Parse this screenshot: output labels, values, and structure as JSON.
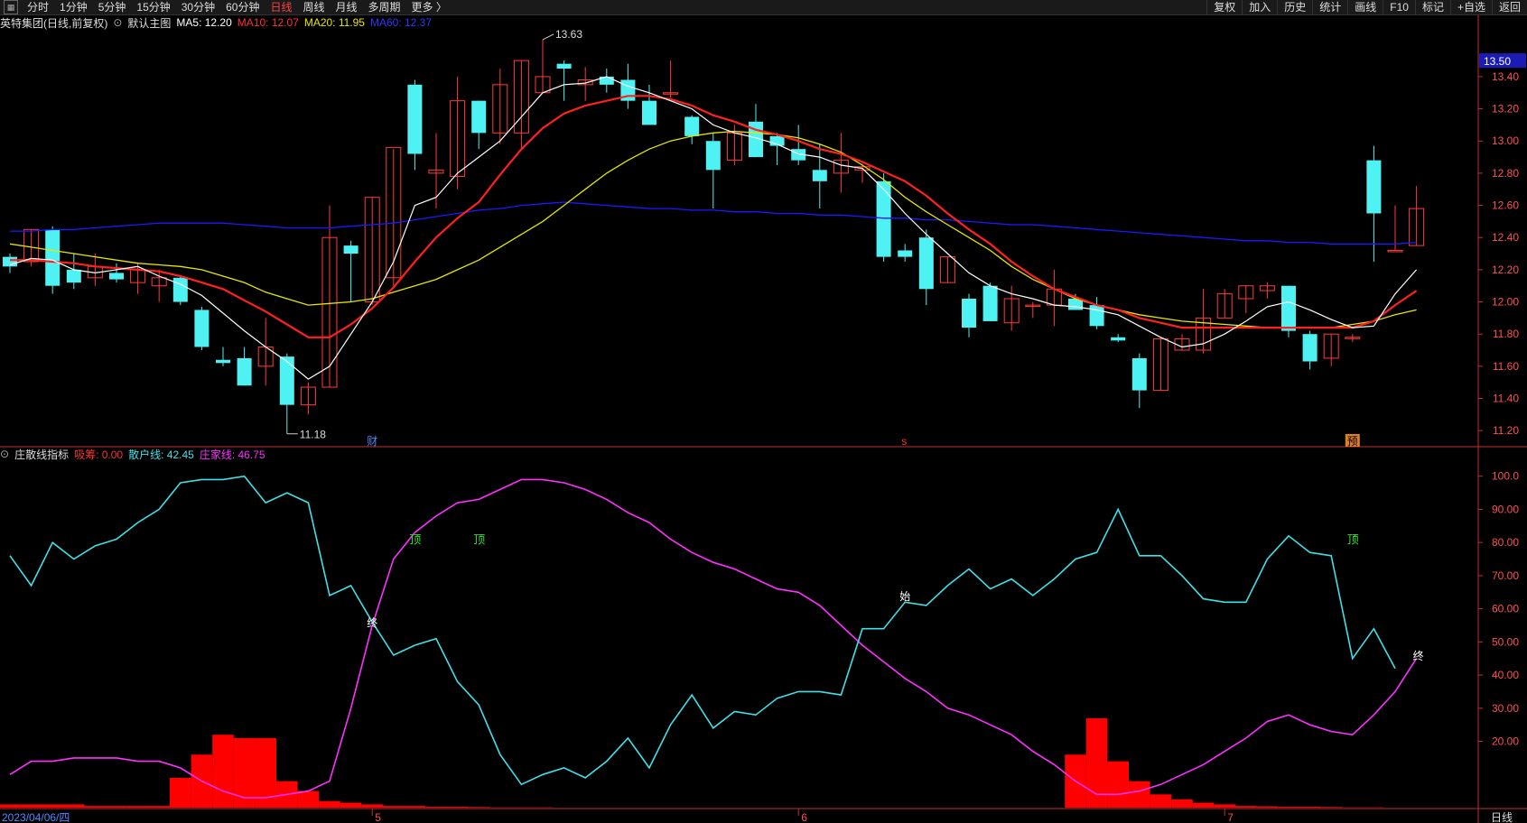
{
  "toolbar": {
    "items": [
      "分时",
      "1分钟",
      "5分钟",
      "15分钟",
      "30分钟",
      "60分钟",
      "日线",
      "周线",
      "月线",
      "多周期",
      "更多 〉"
    ],
    "active": "日线",
    "right_items": [
      "复权",
      "加入",
      "历史",
      "统计",
      "画线",
      "F10",
      "标记",
      "+自选",
      "返回"
    ]
  },
  "main_header": {
    "stock": "英特集团(日线,前复权)",
    "chart_name": "默认主图",
    "ma5_label": "MA5: 12.20",
    "ma10_label": "MA10: 12.07",
    "ma20_label": "MA20: 11.95",
    "ma60_label": "MA60: 12.37"
  },
  "sub_header": {
    "indicator": "庄散线指标",
    "xichou_label": "吸筹: 0.00",
    "sanhu_label": "散户线: 42.45",
    "zhuangjia_label": "庄家线: 46.75"
  },
  "colors": {
    "up": "#ff3a3a",
    "down": "#4ef2f2",
    "ma5": "#ffffff",
    "ma10": "#ff2020",
    "ma20": "#e6e600",
    "ma60": "#1a1aff",
    "sanhu": "#40e0e8",
    "zhuangjia": "#ff30ff",
    "xichou": "#ff0000"
  },
  "main_axis": {
    "ticks": [
      "13.40",
      "13.20",
      "13.00",
      "12.80",
      "12.60",
      "12.40",
      "12.20",
      "12.00",
      "11.80",
      "11.60",
      "11.40",
      "11.20"
    ],
    "current_price": "13.50",
    "high_label": "13.63",
    "low_label": "11.18"
  },
  "sub_axis": {
    "ticks": [
      "100.0",
      "90.00",
      "80.00",
      "70.00",
      "60.00",
      "50.00",
      "40.00",
      "30.00",
      "20.00"
    ]
  },
  "markers": {
    "cai": "财",
    "s": "s",
    "yu": "预",
    "ding": "顶",
    "zhong": "终",
    "shi": "始"
  },
  "date_axis": {
    "start": "2023/04/06/四",
    "month_labels": [
      "5",
      "6",
      "7"
    ],
    "period": "日线"
  },
  "chart_data": [
    {
      "type": "candlestick",
      "title": "英特集团(日线,前复权)",
      "ylim": [
        11.1,
        13.68
      ],
      "candles": [
        [
          12.28,
          12.3,
          12.18,
          12.22
        ],
        [
          12.25,
          12.45,
          12.22,
          12.45
        ],
        [
          12.45,
          12.47,
          12.05,
          12.1
        ],
        [
          12.2,
          12.3,
          12.08,
          12.12
        ],
        [
          12.15,
          12.3,
          12.1,
          12.22
        ],
        [
          12.18,
          12.24,
          12.12,
          12.14
        ],
        [
          12.12,
          12.24,
          12.05,
          12.2
        ],
        [
          12.1,
          12.2,
          12.0,
          12.15
        ],
        [
          12.15,
          12.16,
          11.98,
          12.0
        ],
        [
          11.95,
          11.97,
          11.7,
          11.72
        ],
        [
          11.64,
          11.72,
          11.6,
          11.62
        ],
        [
          11.65,
          11.72,
          11.48,
          11.48
        ],
        [
          11.6,
          11.9,
          11.48,
          11.72
        ],
        [
          11.66,
          11.68,
          11.18,
          11.36
        ],
        [
          11.36,
          11.5,
          11.3,
          11.47
        ],
        [
          11.47,
          12.6,
          11.47,
          12.4
        ],
        [
          12.35,
          12.38,
          12.0,
          12.3
        ],
        [
          12.0,
          12.65,
          11.98,
          12.65
        ],
        [
          12.15,
          12.95,
          12.1,
          12.96
        ],
        [
          13.35,
          13.38,
          12.82,
          12.92
        ],
        [
          12.8,
          13.05,
          12.58,
          12.82
        ],
        [
          12.78,
          13.4,
          12.7,
          13.25
        ],
        [
          13.25,
          13.25,
          12.95,
          13.05
        ],
        [
          13.05,
          13.45,
          12.98,
          13.35
        ],
        [
          13.05,
          13.5,
          12.95,
          13.5
        ],
        [
          13.3,
          13.63,
          13.3,
          13.4
        ],
        [
          13.48,
          13.5,
          13.25,
          13.45
        ],
        [
          13.35,
          13.46,
          13.25,
          13.38
        ],
        [
          13.4,
          13.45,
          13.3,
          13.35
        ],
        [
          13.38,
          13.48,
          13.2,
          13.25
        ],
        [
          13.25,
          13.35,
          13.1,
          13.1
        ],
        [
          13.3,
          13.5,
          13.27,
          13.3
        ],
        [
          13.15,
          13.16,
          12.98,
          13.03
        ],
        [
          13.0,
          13.05,
          12.58,
          12.82
        ],
        [
          12.88,
          13.1,
          12.85,
          13.05
        ],
        [
          13.12,
          13.23,
          12.9,
          12.9
        ],
        [
          13.03,
          13.05,
          12.85,
          12.97
        ],
        [
          12.95,
          13.1,
          12.85,
          12.88
        ],
        [
          12.82,
          12.98,
          12.58,
          12.75
        ],
        [
          12.8,
          13.05,
          12.68,
          12.88
        ],
        [
          12.82,
          12.86,
          12.74,
          12.84
        ],
        [
          12.75,
          12.8,
          12.25,
          12.28
        ],
        [
          12.32,
          12.36,
          12.25,
          12.28
        ],
        [
          12.4,
          12.45,
          11.98,
          12.08
        ],
        [
          12.12,
          12.28,
          12.12,
          12.28
        ],
        [
          12.02,
          12.05,
          11.78,
          11.84
        ],
        [
          12.1,
          12.12,
          11.88,
          11.88
        ],
        [
          11.87,
          12.1,
          11.82,
          12.02
        ],
        [
          11.98,
          12.0,
          11.9,
          11.98
        ],
        [
          11.98,
          12.2,
          11.85,
          12.08
        ],
        [
          12.02,
          12.05,
          11.95,
          11.95
        ],
        [
          11.98,
          12.03,
          11.83,
          11.85
        ],
        [
          11.78,
          11.8,
          11.75,
          11.76
        ],
        [
          11.65,
          11.68,
          11.34,
          11.45
        ],
        [
          11.45,
          11.78,
          11.45,
          11.77
        ],
        [
          11.7,
          11.8,
          11.7,
          11.77
        ],
        [
          11.7,
          12.08,
          11.68,
          11.9
        ],
        [
          11.9,
          12.08,
          11.9,
          12.05
        ],
        [
          12.02,
          12.1,
          11.93,
          12.1
        ],
        [
          12.07,
          12.12,
          12.02,
          12.1
        ],
        [
          12.1,
          12.1,
          11.78,
          11.82
        ],
        [
          11.8,
          11.82,
          11.58,
          11.63
        ],
        [
          11.65,
          11.8,
          11.6,
          11.8
        ],
        [
          11.78,
          11.8,
          11.75,
          11.78
        ],
        [
          12.88,
          12.97,
          12.25,
          12.55
        ],
        [
          12.32,
          12.6,
          12.32,
          12.32
        ],
        [
          12.35,
          12.72,
          12.35,
          12.58
        ]
      ],
      "ma5": [
        12.23,
        12.27,
        12.26,
        12.2,
        12.18,
        12.2,
        12.22,
        12.16,
        12.11,
        12.04,
        11.93,
        11.82,
        11.72,
        11.63,
        11.52,
        11.6,
        11.8,
        12.0,
        12.25,
        12.6,
        12.65,
        12.8,
        12.9,
        13.0,
        13.15,
        13.3,
        13.35,
        13.36,
        13.4,
        13.34,
        13.3,
        13.25,
        13.2,
        13.1,
        13.05,
        13.02,
        12.98,
        12.92,
        12.9,
        12.85,
        12.83,
        12.7,
        12.55,
        12.42,
        12.3,
        12.18,
        12.1,
        12.05,
        12.02,
        11.98,
        11.97,
        11.95,
        11.92,
        11.85,
        11.78,
        11.72,
        11.74,
        11.8,
        11.88,
        11.97,
        12.0,
        11.95,
        11.89,
        11.84,
        11.85,
        12.05,
        12.2
      ],
      "ma10": [
        12.26,
        12.26,
        12.25,
        12.24,
        12.22,
        12.21,
        12.2,
        12.19,
        12.16,
        12.12,
        12.08,
        12.01,
        11.94,
        11.86,
        11.78,
        11.78,
        11.86,
        11.96,
        12.09,
        12.25,
        12.4,
        12.52,
        12.62,
        12.79,
        12.95,
        13.08,
        13.17,
        13.22,
        13.25,
        13.28,
        13.28,
        13.26,
        13.22,
        13.16,
        13.12,
        13.07,
        13.04,
        13.0,
        12.95,
        12.92,
        12.87,
        12.81,
        12.75,
        12.66,
        12.55,
        12.45,
        12.36,
        12.25,
        12.16,
        12.08,
        12.03,
        11.98,
        11.95,
        11.9,
        11.87,
        11.84,
        11.84,
        11.84,
        11.84,
        11.84,
        11.84,
        11.84,
        11.84,
        11.84,
        11.88,
        11.98,
        12.07
      ],
      "ma20": [
        12.36,
        12.34,
        12.32,
        12.3,
        12.28,
        12.26,
        12.24,
        12.23,
        12.22,
        12.2,
        12.16,
        12.12,
        12.06,
        12.02,
        11.98,
        11.99,
        12.0,
        12.02,
        12.06,
        12.1,
        12.14,
        12.2,
        12.26,
        12.34,
        12.42,
        12.5,
        12.6,
        12.7,
        12.8,
        12.88,
        12.95,
        13.0,
        13.03,
        13.05,
        13.06,
        13.05,
        13.04,
        13.02,
        12.98,
        12.93,
        12.85,
        12.76,
        12.65,
        12.56,
        12.48,
        12.4,
        12.32,
        12.22,
        12.14,
        12.08,
        12.02,
        11.98,
        11.95,
        11.92,
        11.9,
        11.88,
        11.87,
        11.86,
        11.85,
        11.84,
        11.84,
        11.84,
        11.84,
        11.86,
        11.88,
        11.92,
        11.95
      ],
      "ma60": [
        12.44,
        12.44,
        12.45,
        12.45,
        12.46,
        12.47,
        12.48,
        12.49,
        12.49,
        12.49,
        12.49,
        12.48,
        12.47,
        12.46,
        12.46,
        12.46,
        12.47,
        12.48,
        12.49,
        12.51,
        12.53,
        12.55,
        12.57,
        12.58,
        12.6,
        12.61,
        12.62,
        12.61,
        12.6,
        12.59,
        12.58,
        12.58,
        12.57,
        12.57,
        12.56,
        12.56,
        12.55,
        12.55,
        12.54,
        12.54,
        12.53,
        12.52,
        12.52,
        12.51,
        12.51,
        12.5,
        12.49,
        12.48,
        12.48,
        12.47,
        12.46,
        12.45,
        12.44,
        12.43,
        12.42,
        12.41,
        12.4,
        12.39,
        12.38,
        12.38,
        12.37,
        12.37,
        12.36,
        12.36,
        12.36,
        12.36,
        12.37
      ]
    },
    {
      "type": "line",
      "title": "庄散线指标",
      "ylim": [
        0,
        104
      ],
      "sanhu": [
        76,
        67,
        80,
        75,
        79,
        81,
        86,
        90,
        98,
        99,
        99,
        100,
        92,
        95,
        92,
        64,
        67,
        56,
        46,
        49,
        51,
        38,
        31,
        16,
        7,
        10,
        12,
        9,
        14,
        21,
        12,
        25,
        34,
        24,
        29,
        28,
        33,
        35,
        35,
        34,
        54,
        54,
        62,
        61,
        67,
        72,
        66,
        69,
        64,
        69,
        75,
        77,
        90,
        76,
        76,
        70,
        63,
        62,
        62,
        75,
        82,
        77,
        76,
        45,
        54,
        42
      ],
      "zhuangjia": [
        10,
        14,
        14,
        15,
        15,
        15,
        14,
        14,
        12,
        8,
        5,
        3,
        3,
        4,
        5,
        8,
        30,
        55,
        75,
        83,
        88,
        92,
        93,
        96,
        99,
        99,
        98,
        96,
        93,
        89,
        86,
        81,
        77,
        74,
        72,
        69,
        66,
        65,
        61,
        55,
        49,
        44,
        39,
        35,
        30,
        28,
        25,
        22,
        17,
        13,
        8,
        4,
        4,
        5,
        7,
        10,
        13,
        17,
        21,
        26,
        28,
        25,
        23,
        22,
        28,
        35,
        45
      ],
      "xichou": [
        1,
        1,
        1,
        1,
        0.5,
        0.5,
        0.5,
        0.5,
        9,
        16,
        22,
        21,
        21,
        8,
        5,
        2,
        1.5,
        1,
        0.5,
        0.5,
        0.3,
        0.3,
        0.2,
        0.1,
        0.1,
        0.1,
        0,
        0,
        0,
        0,
        0,
        0,
        0,
        0,
        0,
        0,
        0,
        0,
        0,
        0,
        0,
        0,
        0,
        0,
        0,
        0,
        0,
        0,
        0,
        0,
        16,
        27,
        14,
        8,
        4,
        2.5,
        1.5,
        1,
        0.5,
        0.4,
        0.3,
        0.3,
        0.2,
        0.1,
        0.1,
        0
      ]
    }
  ]
}
